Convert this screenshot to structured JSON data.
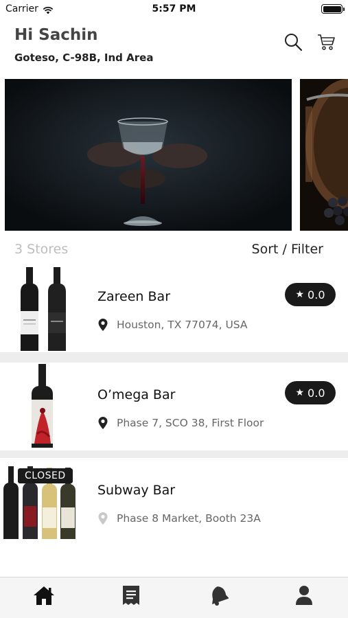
{
  "status_bar": {
    "carrier": "Carrier",
    "time": "5:57 PM"
  },
  "header": {
    "greeting": "Hi Sachin",
    "address": "Goteso, C-98B, Ind Area"
  },
  "stores_section": {
    "count_label": "3 Stores",
    "sort_filter_label": "Sort / Filter"
  },
  "stores": [
    {
      "name": "Zareen Bar",
      "location": "Houston, TX 77074, USA",
      "rating": "0.0"
    },
    {
      "name": "O’mega Bar",
      "location": "Phase 7, SCO 38, First Floor",
      "rating": "0.0"
    },
    {
      "name": "Subway Bar",
      "location": "Phase 8 Market, Booth 23A",
      "status": "CLOSED"
    }
  ],
  "tab_bar": {
    "icons": [
      "home-icon",
      "orders-icon",
      "notifications-icon",
      "profile-icon"
    ]
  },
  "colors": {
    "accent": "#1a1a1a",
    "muted_text": "#666666",
    "list_background": "#ededed"
  }
}
